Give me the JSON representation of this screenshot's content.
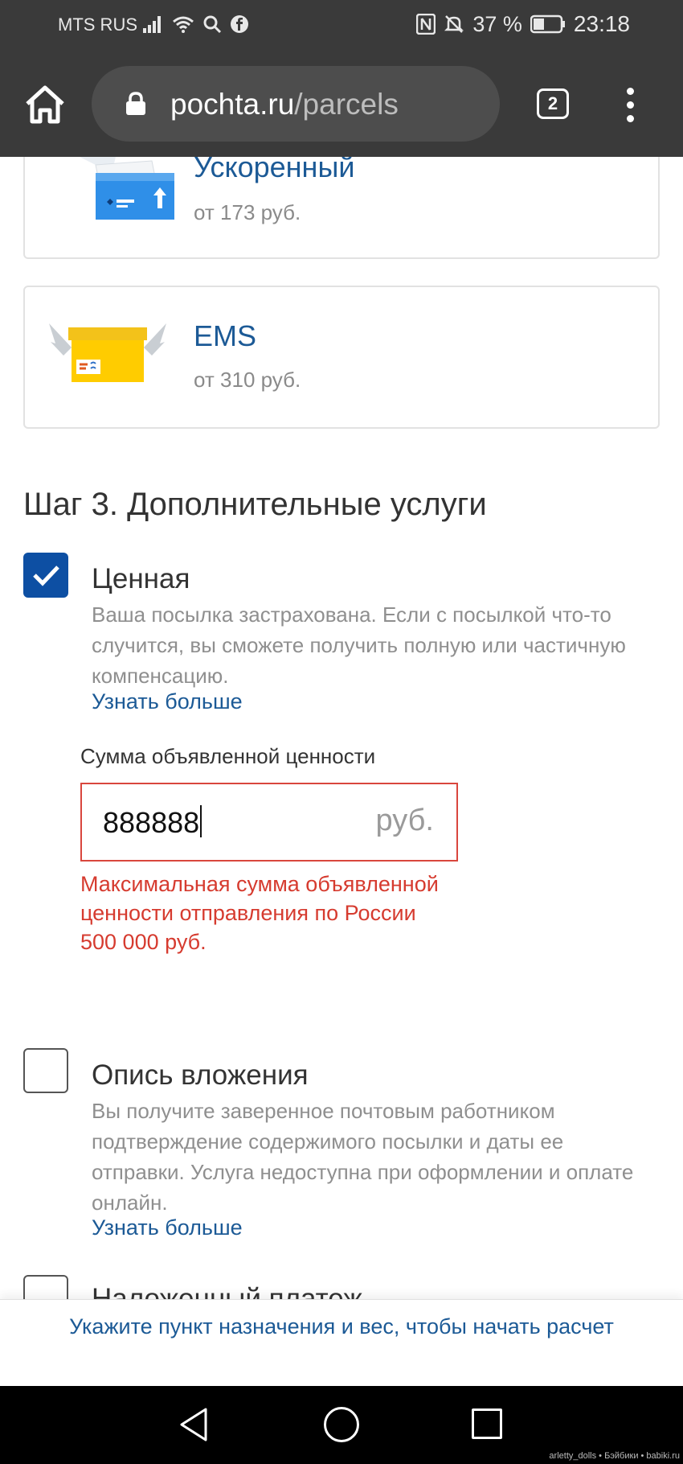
{
  "status_bar": {
    "carrier": "MTS RUS",
    "battery_percent": "37 %",
    "time": "23:18",
    "icons": [
      "signal-icon",
      "wifi-icon",
      "search-icon",
      "facebook-icon",
      "nfc-icon",
      "mute-icon",
      "battery-icon"
    ]
  },
  "browser": {
    "url_host": "pochta.ru",
    "url_path": "/parcels",
    "tab_count": "2"
  },
  "shipping_options": [
    {
      "title": "Ускоренный",
      "price": "от 173 руб.",
      "icon": "express-parcel-icon"
    },
    {
      "title": "EMS",
      "price": "от 310 руб.",
      "icon": "ems-box-icon"
    }
  ],
  "step3": {
    "title": "Шаг 3. Дополнительные услуги",
    "options": [
      {
        "title": "Ценная",
        "checked": true,
        "description": "Ваша посылка застрахована. Если с посылкой что-то случится, вы сможете получить полную или частичную компенсацию.",
        "link": "Узнать больше"
      },
      {
        "title": "Опись вложения",
        "checked": false,
        "description": "Вы получите заверенное почтовым работником подтверждение содержимого посылки и даты ее отправки. Услуга недоступна при оформлении и оплате онлайн.",
        "link": "Узнать больше"
      },
      {
        "title": "Наложенный платеж",
        "checked": false
      }
    ],
    "declared_value": {
      "label": "Сумма объявленной ценности",
      "value": "888888",
      "suffix": "руб.",
      "error": "Максимальная сумма объявленной ценности отправления по России 500 000 руб."
    }
  },
  "banner": {
    "text": "Укажите пункт назначения и вес, чтобы начать расчет"
  },
  "watermark": "arletty_dolls • Бэйбики • babiki.ru",
  "colors": {
    "brand_blue": "#1c5a96",
    "checkbox_blue": "#0d4fa3",
    "error_red": "#d63b2f",
    "toolbar": "#3a3a3a"
  }
}
